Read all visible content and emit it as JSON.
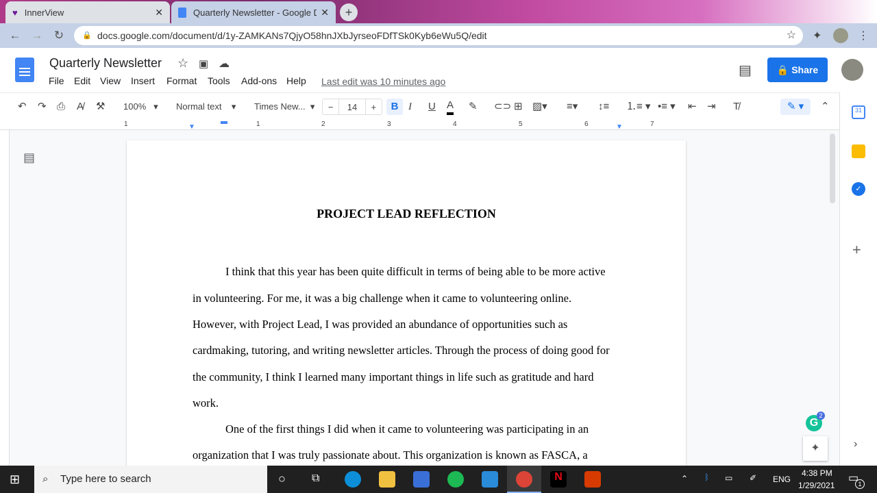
{
  "browser": {
    "tabs": [
      {
        "label": "InnerView"
      },
      {
        "label": "Quarterly Newsletter - Google Do"
      }
    ],
    "url": "docs.google.com/document/d/1y-ZAMKANs7QjyO58hnJXbJyrseoFDfTSk0Kyb6eWu5Q/edit"
  },
  "docs": {
    "title": "Quarterly Newsletter",
    "menu": [
      "File",
      "Edit",
      "View",
      "Insert",
      "Format",
      "Tools",
      "Add-ons",
      "Help"
    ],
    "last_edit": "Last edit was 10 minutes ago",
    "share": "Share"
  },
  "toolbar": {
    "zoom": "100%",
    "style": "Normal text",
    "font": "Times New...",
    "size": "14"
  },
  "ruler": [
    "1",
    "1",
    "2",
    "3",
    "4",
    "5",
    "6",
    "7"
  ],
  "document": {
    "title": "PROJECT LEAD REFLECTION",
    "lines": [
      "I think that this year has been quite difficult in terms of being able to be more active",
      "in volunteering. For me, it was a big challenge when it came to volunteering online.",
      "However, with Project Lead, I was provided an abundance of opportunities such as",
      "cardmaking, tutoring, and writing newsletter articles. Through the process of doing good for",
      "the community, I think I learned many important things in life such as gratitude and hard",
      "work.",
      "One of the first things I did when it came to volunteering was participating in an",
      "organization that I was truly passionate about. This organization is known as FASCA, a"
    ]
  },
  "grammarly_count": "2",
  "taskbar": {
    "search": "Type here to search",
    "lang": "ENG",
    "time": "4:38 PM",
    "date": "1/29/2021",
    "notifications": "1"
  }
}
